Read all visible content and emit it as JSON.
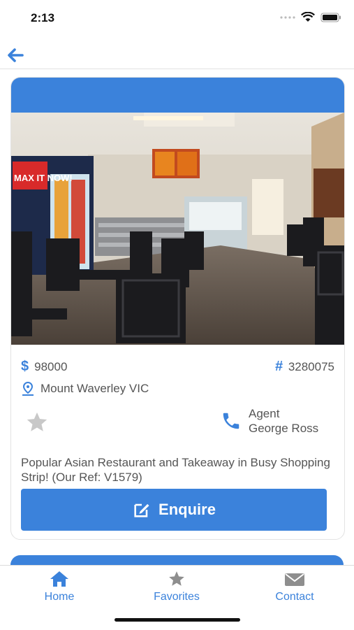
{
  "status": {
    "time": "2:13"
  },
  "listing": {
    "price": "98000",
    "currency_symbol": "$",
    "ref_symbol": "#",
    "ref_number": "3280075",
    "location": "Mount Waverley VIC",
    "agent_label": "Agent",
    "agent_name": "George Ross",
    "description": "Popular Asian Restaurant and Takeaway in Busy Shopping Strip! (Our Ref: V1579)",
    "enquire_label": "Enquire",
    "photo_sign_text": "MAX IT NOW!"
  },
  "tabs": [
    {
      "label": "Home",
      "icon": "home-icon"
    },
    {
      "label": "Favorites",
      "icon": "star-icon"
    },
    {
      "label": "Contact",
      "icon": "mail-icon"
    }
  ],
  "colors": {
    "accent": "#3b82db",
    "text": "#555555",
    "inactive_star": "#c8c8c8"
  }
}
